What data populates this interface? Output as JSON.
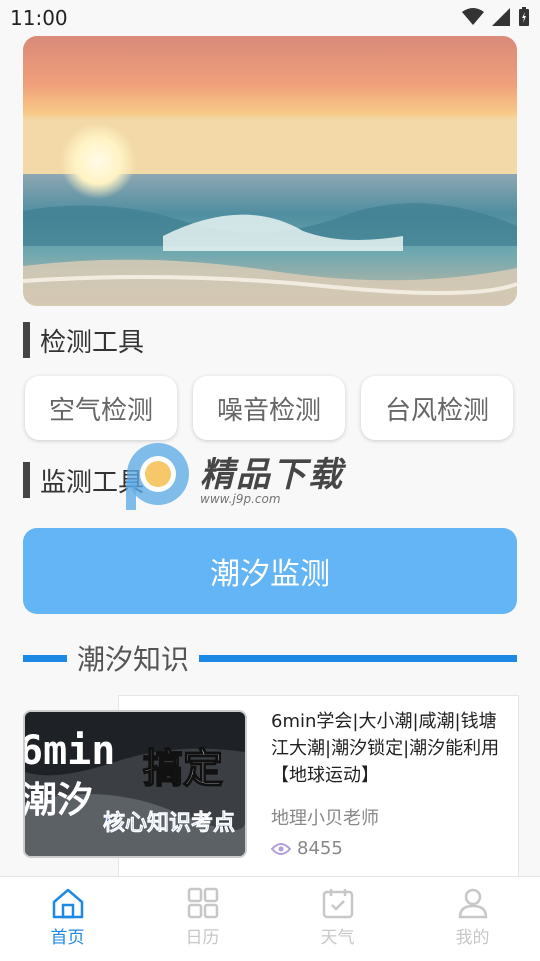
{
  "status": {
    "time": "11:00"
  },
  "sections": {
    "detect_title": "检测工具",
    "monitor_title": "监测工具"
  },
  "detect_tools": [
    "空气检测",
    "噪音检测",
    "台风检测"
  ],
  "tide_button": "潮汐监测",
  "knowledge_title": "潮汐知识",
  "video": {
    "title": "6min学会|大小潮|咸潮|钱塘江大潮|潮汐锁定|潮汐能利用【地球运动】",
    "author": "地理小贝老师",
    "views": "8455",
    "thumb_text": {
      "big": "6min",
      "left": "潮汐",
      "right": "搞定",
      "sub": "核心知识考点"
    }
  },
  "watermark": {
    "brand": "精品下载",
    "url": "www.j9p.com"
  },
  "tabs": [
    {
      "label": "首页",
      "icon": "home-icon",
      "active": true
    },
    {
      "label": "日历",
      "icon": "calendar-grid-icon",
      "active": false
    },
    {
      "label": "天气",
      "icon": "weather-check-icon",
      "active": false
    },
    {
      "label": "我的",
      "icon": "profile-icon",
      "active": false
    }
  ],
  "colors": {
    "accent": "#1e88e5",
    "tide_button": "#64b5f6"
  }
}
